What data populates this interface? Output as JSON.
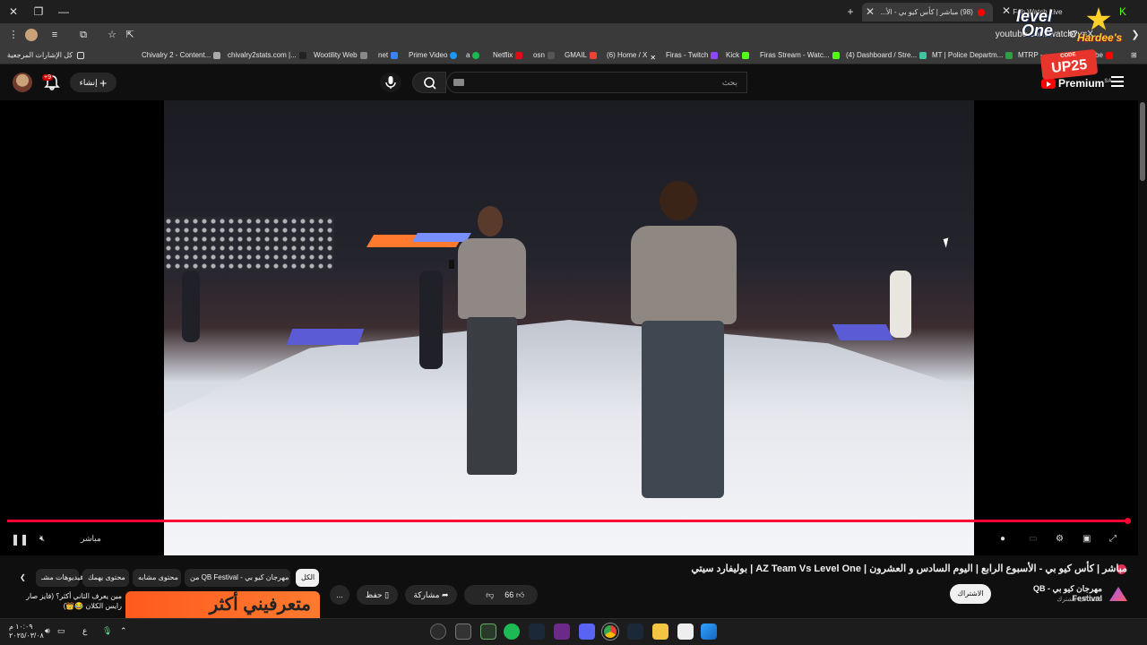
{
  "browser": {
    "tabs": [
      {
        "label": "مباشر | كأس كيو بي - الأ...",
        "prefix": "(98)",
        "active": true
      },
      {
        "label": "Watch Live",
        "prefix": "Fah",
        "active": false
      }
    ],
    "url": "youtube.com/watch?v=X",
    "new_tab": "+"
  },
  "bookmarks": {
    "all_label": "كل الإشارات المرجعية",
    "items": [
      "Chivalry 2 - Content...",
      "chivalry2stats.com |...",
      "Wootility Web",
      "net",
      "Prime Video",
      "a",
      "Netflix",
      "osn",
      "GMAIL",
      "(6) Home / X",
      "Firas - Twitch",
      "Kick",
      "Firas Stream - Watc...",
      "(4) Dashboard / Stre...",
      "MT | Police Departm...",
      "MTRP - ...",
      "be"
    ]
  },
  "youtube": {
    "search_placeholder": "بحث",
    "create_label": "إنشاء",
    "notification_count": "+9",
    "logo_text": "Premium",
    "logo_region": "SA"
  },
  "player": {
    "live_label": "مباشر",
    "progress": 0.995
  },
  "overlay": {
    "brand_line1": "level",
    "brand_line2": "One",
    "sponsor": "Hardee's",
    "promo_small": "CODE",
    "promo_big": "UP25"
  },
  "video": {
    "title": "مباشر | كأس كيو بي - الأسبوع الرابع | اليوم السادس و العشرون | AZ Team Vs Level One | بوليفارد سيتي",
    "channel": "مهرجان كيو بي - QB Festival",
    "subscribers": "15.3 ألف مشترك",
    "subscribe_label": "الاشتراك",
    "like_count": "66",
    "share_label": "مشاركة",
    "save_label": "حفظ",
    "more_label": "..."
  },
  "chips": {
    "all": "الكل",
    "from_channel": "من QB Festival - مهرجان كيو بي",
    "related": "محتوى مشابه",
    "for_you": "محتوى يهمك",
    "videos": "فيديوهات مشـ..."
  },
  "suggestion": {
    "title": "مين يعرف الثاني أكثر؟ (فايز صار رايس الكلان 😂👑)",
    "thumb_text": "متعرفيني أكثر"
  },
  "taskbar": {
    "time": "١٠:٠٩ م",
    "date": "٢٠٢٥/٠٣/٠٨",
    "lang": "ع"
  }
}
